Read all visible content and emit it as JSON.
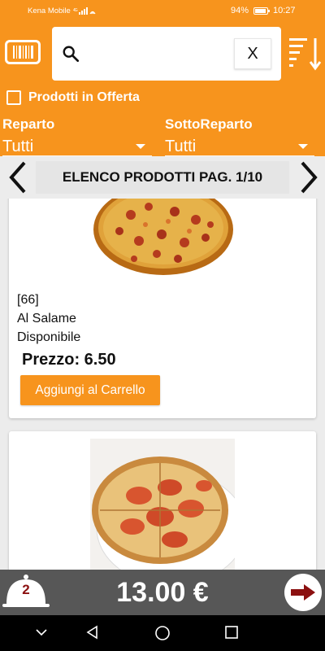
{
  "status": {
    "carrier": "Kena Mobile",
    "signal_text": "4G",
    "battery": "94%",
    "time": "10:27"
  },
  "toolbar": {
    "search_placeholder": "",
    "search_value": "",
    "clear_label": "X",
    "offerta_label": "Prodotti in Offerta",
    "reparto_label": "Reparto",
    "reparto_value": "Tutti",
    "sottoreparto_label": "SottoReparto",
    "sottoreparto_value": "Tutti"
  },
  "pagination": {
    "title": "ELENCO PRODOTTI PAG. 1/10"
  },
  "products": [
    {
      "code": "[66]",
      "name": "Al Salame",
      "availability": "Disponibile",
      "price": "Prezzo: 6.50",
      "add_label": "Aggiungi al Carrello",
      "image": "pizza-salame"
    },
    {
      "image": "pizza-margherita"
    }
  ],
  "cart": {
    "count": "2",
    "total": "13.00 €"
  },
  "colors": {
    "accent": "#f7941d",
    "cart_bar": "#575757",
    "arrow_red": "#8b1010"
  },
  "icons": [
    "barcode-icon",
    "search-icon",
    "sort-icon",
    "chevron-left-icon",
    "chevron-right-icon",
    "cloche-icon",
    "arrow-right-icon",
    "nav-back-icon",
    "nav-home-icon",
    "nav-recents-icon"
  ]
}
